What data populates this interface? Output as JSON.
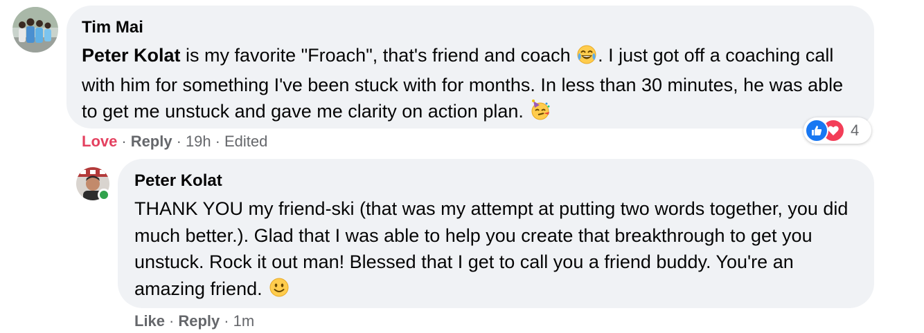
{
  "comment": {
    "author": "Tim Mai",
    "mention": "Peter Kolat",
    "text_1": " is my favorite \"Froach\", that's friend and coach ",
    "text_2": ". I just got off a coaching call with him for something I've been stuck with for months. In less than 30 minutes, he was able to get me unstuck and gave me clarity on action plan. ",
    "emoji_1": "face-with-tears-of-joy",
    "emoji_2": "partying-face",
    "actions": {
      "love": "Love",
      "reply": "Reply",
      "time": "19h",
      "edited": "Edited",
      "separator": "·"
    },
    "reactions": {
      "types": [
        "like",
        "love"
      ],
      "count": "4"
    }
  },
  "reply": {
    "author": "Peter Kolat",
    "text": "THANK YOU my friend-ski (that was my attempt at putting two words together, you did much better.). Glad that I was able to help you create that breakthrough to get you unstuck. Rock it out man! Blessed that I get to call you a friend buddy. You're an amazing friend. ",
    "emoji": "slightly-smiling-face",
    "online": true,
    "actions": {
      "like": "Like",
      "reply": "Reply",
      "time": "1m",
      "separator": "·"
    }
  },
  "colors": {
    "bubble": "#f0f2f5",
    "love": "#e4405f",
    "meta": "#65676b",
    "like_blue": "#1877f2",
    "heart_red": "#f33e58",
    "online": "#31a24c"
  }
}
